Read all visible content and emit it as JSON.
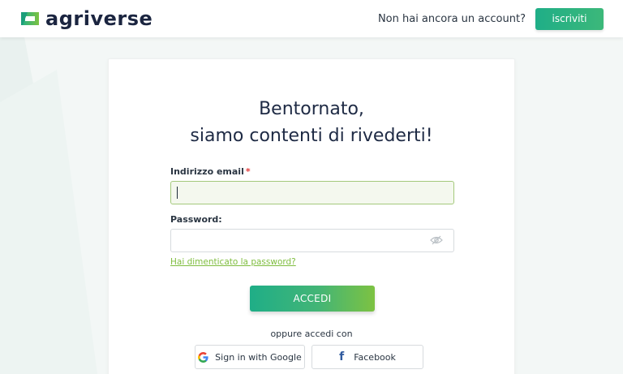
{
  "brand": {
    "name": "agriverse"
  },
  "header": {
    "question": "Non hai ancora un account?",
    "signup_label": "iscriviti"
  },
  "login": {
    "title_line1": "Bentornato,",
    "title_line2": "siamo contenti di rivederti!",
    "email_label": "Indirizzo email",
    "required_marker": "*",
    "email_value": "",
    "password_label": "Password:",
    "password_value": "",
    "forgot_label": "Hai dimenticato la password?",
    "submit_label": "ACCEDI",
    "or_label": "oppure accedi con",
    "google_label": "Sign in with Google",
    "facebook_label": "Facebook"
  },
  "colors": {
    "accent": "#1fae87",
    "accent_end": "#7dc242",
    "brand_text": "#1b2540",
    "link": "#7fbd3f",
    "required": "#e23b3b"
  },
  "icons": {
    "logo": "agriverse-logo-icon",
    "password_toggle": "eye-slash-icon",
    "google": "google-icon",
    "facebook": "facebook-icon"
  }
}
